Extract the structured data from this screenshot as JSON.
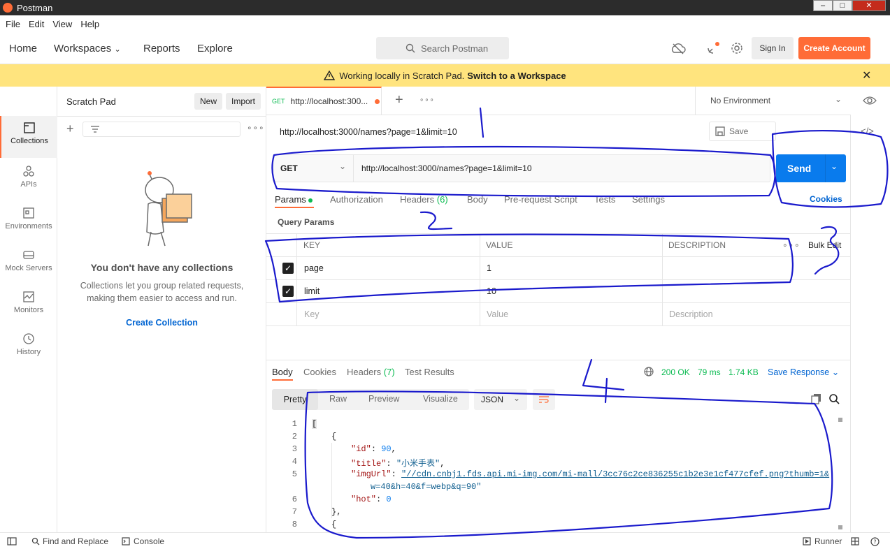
{
  "window": {
    "title": "Postman"
  },
  "menu": [
    "File",
    "Edit",
    "View",
    "Help"
  ],
  "nav": {
    "home": "Home",
    "workspaces": "Workspaces",
    "reports": "Reports",
    "explore": "Explore"
  },
  "search": {
    "placeholder": "Search Postman"
  },
  "header": {
    "signin": "Sign In",
    "create": "Create Account"
  },
  "banner": {
    "text": "Working locally in Scratch Pad.",
    "link": "Switch to a Workspace"
  },
  "sidebar": {
    "title": "Scratch Pad",
    "new": "New",
    "import": "Import",
    "rail": [
      "Collections",
      "APIs",
      "Environments",
      "Mock Servers",
      "Monitors",
      "History"
    ],
    "empty_title": "You don't have any collections",
    "empty_desc_1": "Collections let you group related requests,",
    "empty_desc_2": "making them easier to access and run.",
    "create": "Create Collection"
  },
  "request_tab": {
    "method": "GET",
    "label": "http://localhost:300..."
  },
  "environment": "No Environment",
  "request": {
    "name": "http://localhost:3000/names?page=1&limit=10",
    "save": "Save",
    "method": "GET",
    "url": "http://localhost:3000/names?page=1&limit=10",
    "send": "Send",
    "cookies": "Cookies"
  },
  "req_tabs": {
    "params": "Params",
    "auth": "Authorization",
    "headers": "Headers",
    "headers_count": "(6)",
    "body": "Body",
    "prereq": "Pre-request Script",
    "tests": "Tests",
    "settings": "Settings"
  },
  "query": {
    "title": "Query Params",
    "headers": {
      "key": "KEY",
      "value": "VALUE",
      "desc": "DESCRIPTION",
      "bulk": "Bulk Edit"
    },
    "rows": [
      {
        "key": "page",
        "value": "1",
        "desc": ""
      },
      {
        "key": "limit",
        "value": "10",
        "desc": ""
      }
    ],
    "placeholder": {
      "key": "Key",
      "value": "Value",
      "desc": "Description"
    }
  },
  "response": {
    "tabs": {
      "body": "Body",
      "cookies": "Cookies",
      "headers": "Headers",
      "headers_count": "(7)",
      "tests": "Test Results"
    },
    "status": "200 OK",
    "time": "79 ms",
    "size": "1.74 KB",
    "save": "Save Response",
    "views": {
      "pretty": "Pretty",
      "raw": "Raw",
      "preview": "Preview",
      "visualize": "Visualize"
    },
    "format": "JSON",
    "code": {
      "l1": "[",
      "l2": "{",
      "k3": "\"id\"",
      "v3": "90",
      "k4": "\"title\"",
      "v4": "\"小米手表\"",
      "k5": "\"imgUrl\"",
      "v5a": "\"//cdn.cnbj1.fds.api.mi-img.com/mi-mall/3cc76c2ce836255c1b2e3e1cf477cfef.png?thumb=1&",
      "v5b": "w=40&h=40&f=webp&q=90\"",
      "k6": "\"hot\"",
      "v6": "0",
      "l7": "},",
      "l8": "{"
    },
    "line_numbers": [
      "1",
      "2",
      "3",
      "4",
      "5",
      "6",
      "7",
      "8"
    ]
  },
  "footer": {
    "find": "Find and Replace",
    "console": "Console",
    "runner": "Runner"
  },
  "annotations": {
    "n1": "1",
    "n2": "2",
    "n3": "3",
    "n4": "4"
  }
}
